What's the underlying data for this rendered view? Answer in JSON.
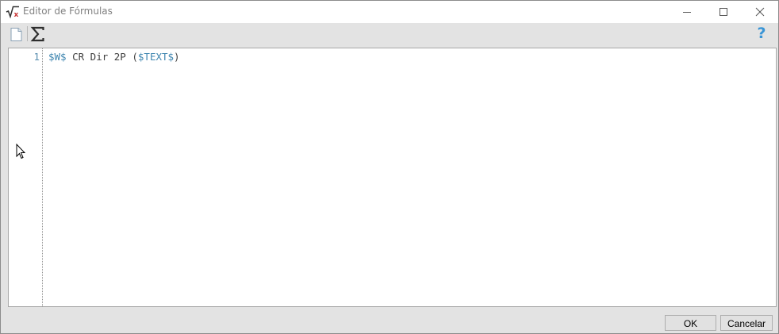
{
  "window": {
    "title": "Editor de Fórmulas",
    "app_icon": "square-root-x-icon",
    "controls": [
      "minimize-icon",
      "maximize-icon",
      "close-icon"
    ]
  },
  "toolbar": {
    "items": [
      "new-document-icon",
      "sigma-icon"
    ],
    "help_label": "?"
  },
  "editor": {
    "lines": [
      {
        "number": "1",
        "tokens": [
          {
            "text": "$W$",
            "kind": "var"
          },
          {
            "text": " CR Dir 2P (",
            "kind": "plain"
          },
          {
            "text": "$TEXT$",
            "kind": "var"
          },
          {
            "text": ")",
            "kind": "plain"
          }
        ]
      }
    ]
  },
  "buttons": {
    "ok_label": "OK",
    "cancel_label": "Cancelar"
  },
  "colors": {
    "variable": "#3f86b0",
    "plain_text": "#404040",
    "help": "#3a95d6"
  }
}
